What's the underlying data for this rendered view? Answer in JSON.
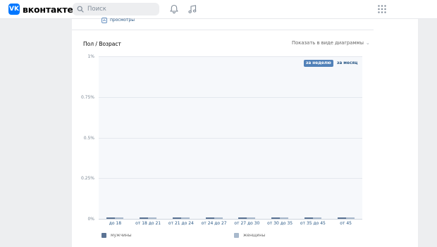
{
  "header": {
    "logo_mark": "VK",
    "logo_text": "вконтакте",
    "search_placeholder": "Поиск",
    "icons": [
      "search-icon",
      "bell-icon",
      "music-icon",
      "apps-grid-icon"
    ]
  },
  "section": {
    "views_label": "просмотры",
    "title": "Пол / Возраст",
    "view_toggle": "Показать в виде диаграммы",
    "period_week": "за неделю",
    "period_month": "за месяц"
  },
  "colors": {
    "male": "#5b7394",
    "female": "#a8b9cc",
    "accent": "#5181b8",
    "link": "#2a5885"
  },
  "chart_data": {
    "type": "bar",
    "title": "Пол / Возраст",
    "categories": [
      "до 18",
      "от 18 до 21",
      "от 21 до 24",
      "от 24 до 27",
      "от 27 до 30",
      "от 30 до 35",
      "от 35 до 45",
      "от 45"
    ],
    "series": [
      {
        "name": "мужчины",
        "values": [
          0,
          0,
          0,
          0,
          0,
          0,
          0,
          0
        ]
      },
      {
        "name": "женщины",
        "values": [
          0,
          0,
          0,
          0,
          0,
          0,
          0,
          0
        ]
      }
    ],
    "y_ticks": [
      "1%",
      "0.75%",
      "0.5%",
      "0.25%",
      "0%"
    ],
    "ylim": [
      0,
      1
    ],
    "grid": true,
    "legend": "bottom"
  }
}
